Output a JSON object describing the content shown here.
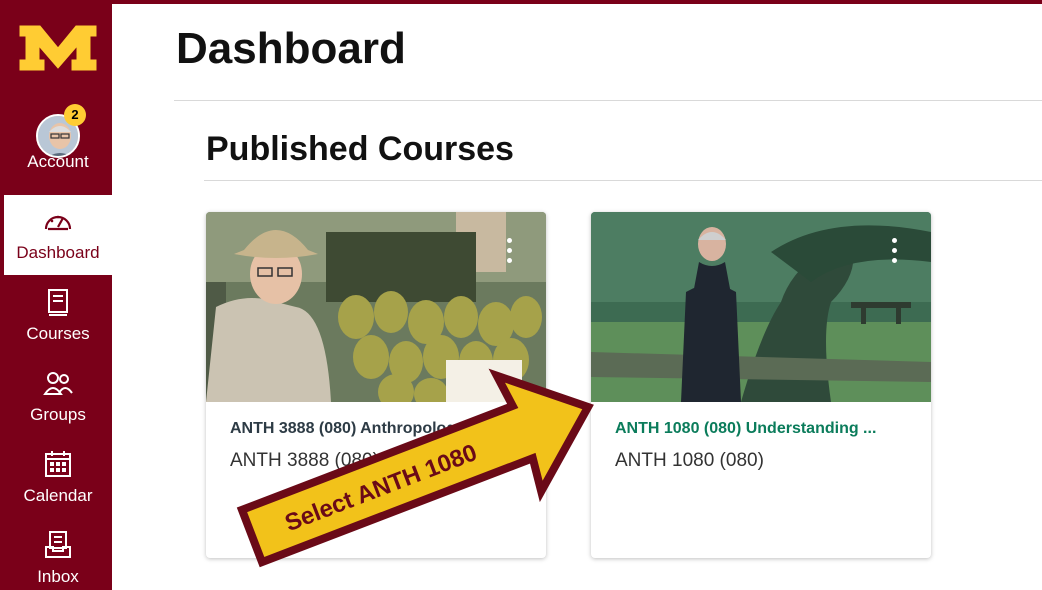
{
  "sidebar": {
    "account_label": "Account",
    "account_badge": "2",
    "items": [
      {
        "label": "Dashboard",
        "icon": "dashboard-gauge-icon",
        "active": true
      },
      {
        "label": "Courses",
        "icon": "book-icon"
      },
      {
        "label": "Groups",
        "icon": "groups-people-icon"
      },
      {
        "label": "Calendar",
        "icon": "calendar-icon"
      },
      {
        "label": "Inbox",
        "icon": "inbox-icon"
      }
    ]
  },
  "header": {
    "title": "Dashboard"
  },
  "main": {
    "section_title": "Published Courses",
    "courses": [
      {
        "name": "ANTH 3888 (080) Anthropology o...",
        "code": "ANTH 3888 (080)",
        "name_color": "#2d3b45"
      },
      {
        "name": "ANTH 1080 (080) Understanding ...",
        "code": "ANTH 1080 (080)",
        "name_color": "#0b7c5b"
      }
    ]
  },
  "callout": {
    "text": "Select ANTH 1080"
  },
  "colors": {
    "brand": "#7a0019",
    "accent_gold": "#ffcc33",
    "course_green": "#0b7c5b"
  }
}
